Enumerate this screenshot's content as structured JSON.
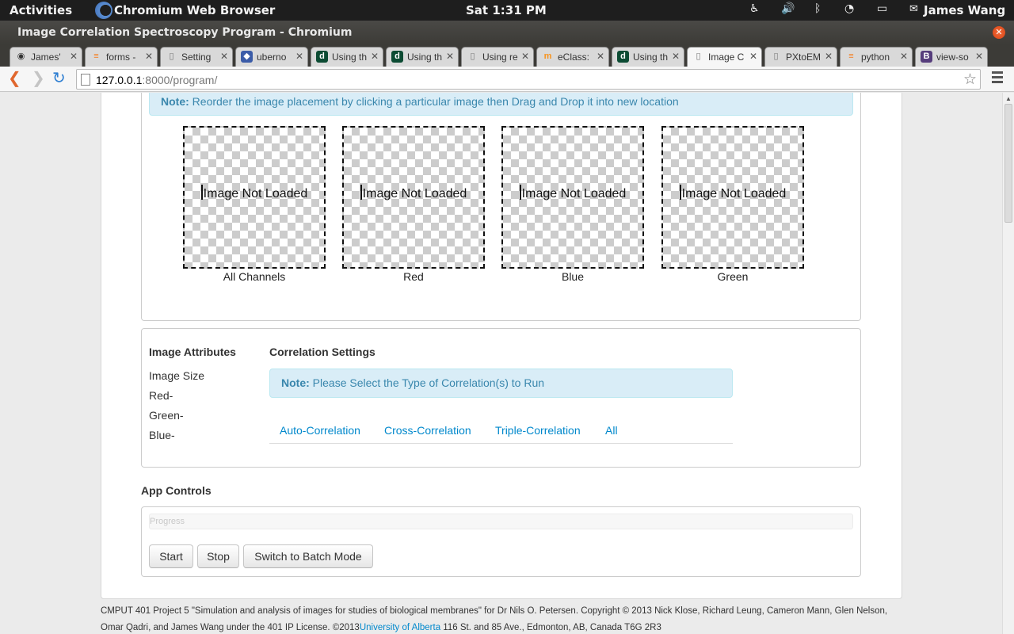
{
  "topbar": {
    "activities": "Activities",
    "app_name": "Chromium Web Browser",
    "clock": "Sat  1:31 PM",
    "user": "James Wang",
    "icons": [
      "accessibility-icon",
      "volume-icon",
      "bluetooth-icon",
      "wifi-icon",
      "battery-icon",
      "chat-icon"
    ]
  },
  "window": {
    "title": "Image Correlation Spectroscopy Program - Chromium"
  },
  "tabs": [
    {
      "label": "James'",
      "icon": "github-icon",
      "color": "#333333"
    },
    {
      "label": "forms -",
      "icon": "stackoverflow-icon",
      "color": "#f48024"
    },
    {
      "label": "Setting",
      "icon": "page-icon",
      "color": "#ffffff"
    },
    {
      "label": "uberno",
      "icon": "shield-icon",
      "color": "#3b5ca8"
    },
    {
      "label": "Using th",
      "icon": "django-icon",
      "color": "#0c4b33"
    },
    {
      "label": "Using th",
      "icon": "django-icon",
      "color": "#0c4b33"
    },
    {
      "label": "Using re",
      "icon": "page-icon",
      "color": "#ffffff"
    },
    {
      "label": "eClass:",
      "icon": "moodle-icon",
      "color": "#f7931e"
    },
    {
      "label": "Using th",
      "icon": "django-icon",
      "color": "#0c4b33"
    },
    {
      "label": "Image C",
      "icon": "page-icon",
      "color": "#ffffff"
    },
    {
      "label": "PXtoEM",
      "icon": "page-icon",
      "color": "#ffffff"
    },
    {
      "label": "python",
      "icon": "stackoverflow-icon",
      "color": "#f48024"
    },
    {
      "label": "view-so",
      "icon": "bootstrap-icon",
      "color": "#563d7c"
    }
  ],
  "omnibox": {
    "url_host": "127.0.0.1",
    "url_rest": ":8000/program/"
  },
  "images_panel": {
    "note_label": "Note:",
    "note_text": " Reorder the image placement by clicking a particular image then Drag and Drop it into new location",
    "placeholder": "Image Not Loaded",
    "captions": [
      "All Channels",
      "Red",
      "Blue",
      "Green"
    ]
  },
  "attributes": {
    "title": "Image Attributes",
    "items": [
      "Image Size",
      "Red-",
      "Green-",
      "Blue-"
    ]
  },
  "correlation": {
    "title": "Correlation Settings",
    "note_label": "Note:",
    "note_text": " Please Select the Type of Correlation(s) to Run",
    "tabs": [
      "Auto-Correlation",
      "Cross-Correlation",
      "Triple-Correlation",
      "All"
    ]
  },
  "app_controls": {
    "title": "App Controls",
    "progress_text": "Progress",
    "progress_value": 0,
    "buttons": [
      "Start",
      "Stop",
      "Switch to Batch Mode"
    ]
  },
  "footer": {
    "text1": "CMPUT 401 Project 5 \"Simulation and analysis of images for studies of biological membranes\" for Dr Nils O. Petersen. Copyright © 2013 Nick Klose, Richard Leung, Cameron Mann, Glen Nelson, Omar Qadri, and James Wang under the 401 IP License. ©2013",
    "link": "University of Alberta",
    "text2": " 116 St. and 85 Ave., Edmonton, AB, Canada T6G 2R3"
  }
}
